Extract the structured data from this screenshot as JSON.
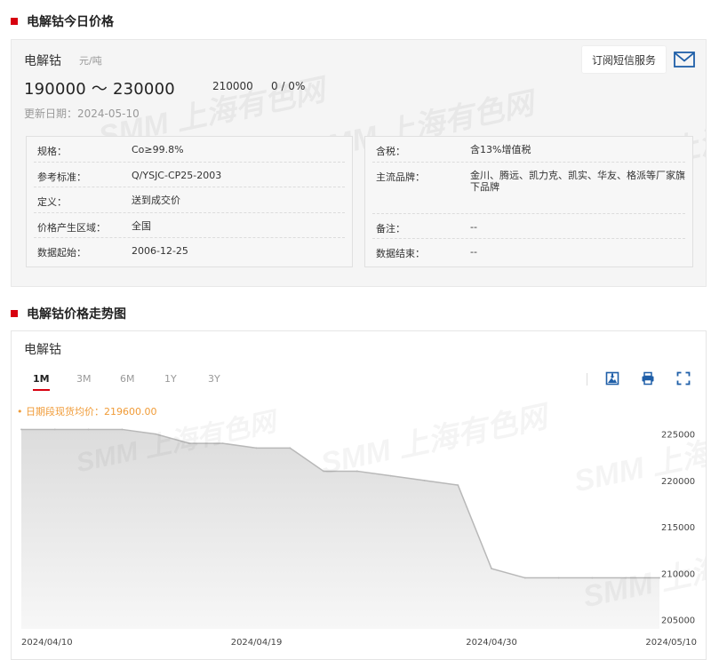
{
  "section1": {
    "title": "电解钴今日价格"
  },
  "product": {
    "name": "电解钴",
    "unit": "元/吨",
    "price_range": "190000 ～ 230000",
    "avg_price": "210000",
    "change": "0 / 0%",
    "update_label": "更新日期：",
    "update_date": "2024-05-10"
  },
  "subscribe": {
    "label": "订阅短信服务",
    "icon": "mail-icon"
  },
  "info_left": [
    {
      "key": "规格：",
      "value": "Co≥99.8%"
    },
    {
      "key": "参考标准：",
      "value": "Q/YSJC-CP25-2003"
    },
    {
      "key": "定义：",
      "value": "送到成交价"
    },
    {
      "key": "价格产生区域：",
      "value": "全国"
    },
    {
      "key": "数据起始：",
      "value": "2006-12-25"
    }
  ],
  "info_right": [
    {
      "key": "含税：",
      "value": "含13%增值税"
    },
    {
      "key": "主流品牌：",
      "value": "金川、腾远、凯力克、凯实、华友、格派等厂家旗下品牌"
    },
    {
      "key": "备注：",
      "value": "--"
    },
    {
      "key": "数据结束：",
      "value": "--"
    }
  ],
  "section2": {
    "title": "电解钴价格走势图"
  },
  "chart": {
    "title": "电解钴",
    "tabs": [
      "1M",
      "3M",
      "6M",
      "1Y",
      "3Y"
    ],
    "active_tab": "1M",
    "tools": [
      "image-download-icon",
      "print-icon",
      "fullscreen-icon"
    ],
    "avg_legend": "• 日期段现货均价：219600.00",
    "watermark": "SMM 上海有色网"
  },
  "chart_data": {
    "type": "area",
    "x": [
      "2024/04/10",
      "2024/04/11",
      "2024/04/12",
      "2024/04/15",
      "2024/04/16",
      "2024/04/17",
      "2024/04/18",
      "2024/04/19",
      "2024/04/22",
      "2024/04/23",
      "2024/04/24",
      "2024/04/25",
      "2024/04/26",
      "2024/04/29",
      "2024/04/30",
      "2024/05/06",
      "2024/05/07",
      "2024/05/08",
      "2024/05/09",
      "2024/05/10"
    ],
    "series": [
      {
        "values": [
          225500,
          225500,
          225500,
          225500,
          225000,
          224000,
          224000,
          223500,
          223500,
          221000,
          221000,
          220500,
          220000,
          219500,
          210500,
          209500,
          209500,
          209500,
          209500,
          209500
        ]
      }
    ],
    "x_tick_labels": [
      "2024/04/10",
      "2024/04/19",
      "2024/04/30",
      "2024/05/10"
    ],
    "y_ticks": [
      205000,
      210000,
      215000,
      220000,
      225000
    ],
    "ylim": [
      204000,
      226500
    ],
    "y_axis_side": "right",
    "line_color": "#b8b8b8",
    "fill_color_top": "#dcdcdc",
    "fill_color_bottom": "#f7f7f7"
  },
  "colors": {
    "accent": "#d7000f",
    "avg_legend": "#f09b37",
    "icon_blue": "#1f5fa8"
  }
}
